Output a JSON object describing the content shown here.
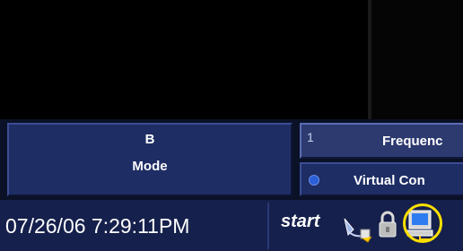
{
  "mode_button": {
    "line1": "B",
    "line2": "Mode"
  },
  "frequency_button": {
    "index": "1",
    "label": "Frequenc"
  },
  "virtual_button": {
    "label": "Virtual Con"
  },
  "status_bar": {
    "datetime": "07/26/06 7:29:11PM",
    "start_label": "start"
  },
  "icons": [
    "usb-device-icon",
    "lock-icon",
    "network-computer-icon"
  ],
  "colors": {
    "panel": "#1e2d64",
    "panel_selected": "#2c3a70",
    "status_bar": "#16204c",
    "highlight": "#ffe000"
  }
}
